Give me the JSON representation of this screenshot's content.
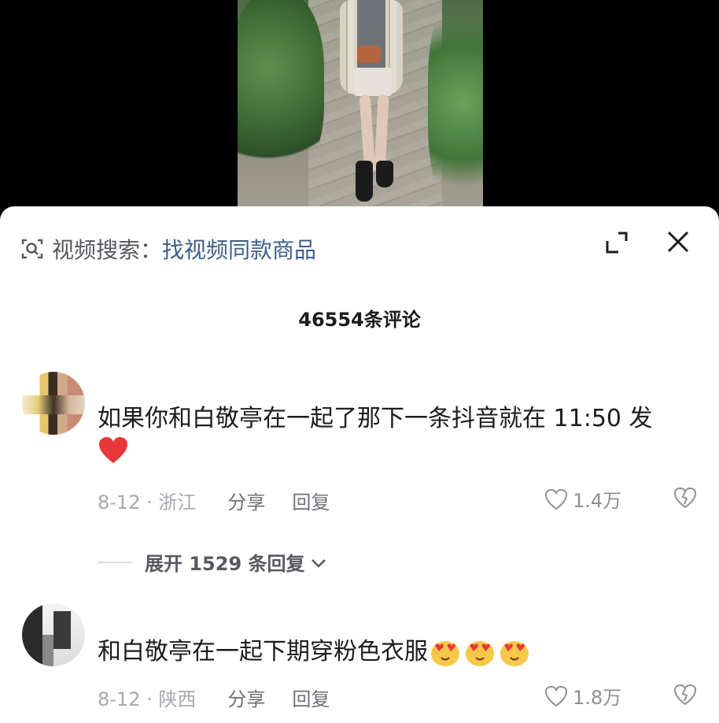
{
  "search": {
    "prefix": "视频搜索：",
    "link": "找视频同款商品"
  },
  "comment_count_label": "46554条评论",
  "comments": [
    {
      "text": "如果你和白敬亭在一起了那下一条抖音就在 11:50 发",
      "emoji": "❤️",
      "date_location": "8-12 · 浙江",
      "share_label": "分享",
      "reply_label": "回复",
      "likes": "1.4万"
    },
    {
      "text": "和白敬亭在一起下期穿粉色衣服",
      "emoji_names": [
        "heart-eyes-emoji",
        "heart-eyes-emoji",
        "heart-eyes-emoji"
      ],
      "date_location": "8-12 · 陕西",
      "share_label": "分享",
      "reply_label": "回复",
      "likes": "1.8万"
    }
  ],
  "replies_toggle": {
    "label": "展开 1529 条回复"
  },
  "colors": {
    "link": "#3b5f88",
    "heart": "#e8373a",
    "meta": "#a7a9ae"
  },
  "icons": [
    "scan-search-icon",
    "expand-icon",
    "close-icon",
    "heart-outline-icon",
    "broken-heart-icon",
    "chevron-down-icon"
  ]
}
